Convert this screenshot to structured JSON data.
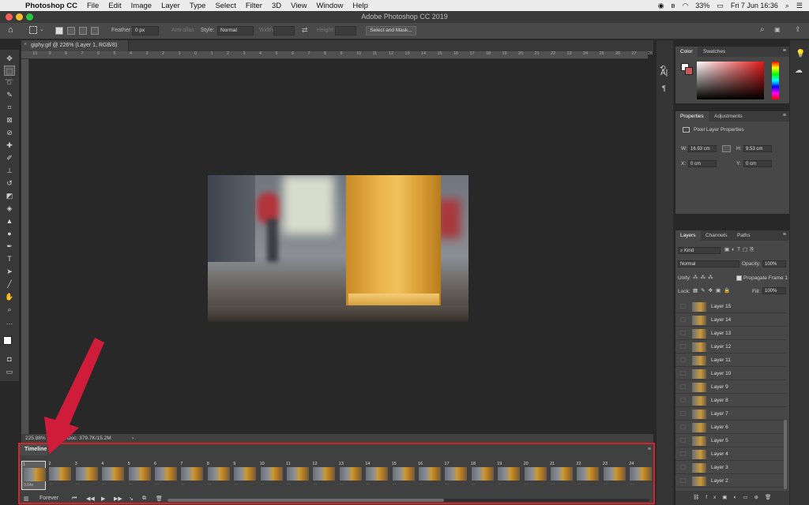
{
  "menubar": {
    "app": "Photoshop CC",
    "items": [
      "File",
      "Edit",
      "Image",
      "Layer",
      "Type",
      "Select",
      "Filter",
      "3D",
      "View",
      "Window",
      "Help"
    ],
    "battery": "33%",
    "datetime": "Fri 7 Jun  16:36"
  },
  "window": {
    "title": "Adobe Photoshop CC 2019"
  },
  "options": {
    "feather_label": "Feather:",
    "feather_value": "0 px",
    "antialias_label": "Anti-alias",
    "style_label": "Style:",
    "style_value": "Normal",
    "width_label": "Width:",
    "height_label": "Height:",
    "select_mask_label": "Select and Mask..."
  },
  "document": {
    "tab_label": "giphy.gif @ 226% (Layer 1, RGB/8)"
  },
  "ruler_ticks": [
    "10",
    "9",
    "8",
    "7",
    "6",
    "5",
    "4",
    "3",
    "2",
    "1",
    "0",
    "1",
    "2",
    "3",
    "4",
    "5",
    "6",
    "7",
    "8",
    "9",
    "10",
    "11",
    "12",
    "13",
    "14",
    "15",
    "16",
    "17",
    "18",
    "19",
    "20",
    "21",
    "22",
    "23",
    "24",
    "25",
    "26",
    "27",
    "28"
  ],
  "status": {
    "zoom": "225.88%",
    "doc": "Doc: 379.7K/15.2M"
  },
  "timeline": {
    "title": "Timeline",
    "loop": "Forever",
    "first_delay": "0.04s",
    "frames": [
      "1",
      "2",
      "3",
      "4",
      "5",
      "6",
      "7",
      "8",
      "9",
      "10",
      "11",
      "12",
      "13",
      "14",
      "15",
      "16",
      "17",
      "18",
      "19",
      "20",
      "21",
      "22",
      "23",
      "24"
    ]
  },
  "color_panel": {
    "tabs": [
      "Color",
      "Swatches"
    ]
  },
  "properties_panel": {
    "tabs": [
      "Properties",
      "Adjustments"
    ],
    "subtitle": "Pixel Layer Properties",
    "w_label": "W:",
    "w_value": "16.93 cm",
    "h_label": "H:",
    "h_value": "9.53 cm",
    "x_label": "X:",
    "x_value": "0 cm",
    "y_label": "Y:",
    "y_value": "0 cm"
  },
  "layers_panel": {
    "tabs": [
      "Layers",
      "Channels",
      "Paths"
    ],
    "kind_label": "Kind",
    "blend_mode": "Normal",
    "opacity_label": "Opacity:",
    "opacity_value": "100%",
    "unify_label": "Unify:",
    "propagate_label": "Propagate Frame 1",
    "lock_label": "Lock:",
    "fill_label": "Fill:",
    "fill_value": "100%",
    "layers": [
      "Layer 15",
      "Layer 14",
      "Layer 13",
      "Layer 12",
      "Layer 11",
      "Layer 10",
      "Layer 9",
      "Layer 8",
      "Layer 7",
      "Layer 6",
      "Layer 5",
      "Layer 4",
      "Layer 3",
      "Layer 2"
    ]
  },
  "colors": {
    "annotation_red": "#d3242c",
    "foreground": "#ffffff",
    "background": "#c45a5a"
  }
}
